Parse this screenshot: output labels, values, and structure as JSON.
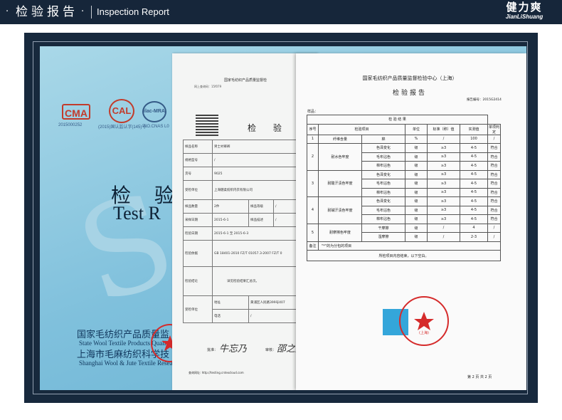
{
  "header": {
    "dot": "·",
    "title_cn": "检验报告",
    "title_en": "Inspection Report",
    "brand_cn": "健力爽",
    "brand_en": "JianLiShuang"
  },
  "cover": {
    "logo_ma": "CMA",
    "logo_cal": "CAL",
    "logo_ilac": "ilac-MRA",
    "code_ma": "2015000252",
    "code_cal": "(2015)国认监认字(145)号",
    "code_ilac": "NO.CNAS L0",
    "title_cn": "检 验",
    "title_en": "Test R",
    "inst_cn": "国家毛纺织产品质量监",
    "inst_en": "State Wool Textile Products Quali",
    "inst2_cn": "上海市毛麻纺织科学技",
    "inst2_en": "Shanghai Wool & Jute Textile Resea"
  },
  "sheet1": {
    "org": "国家毛纺织产品质量监督检",
    "report_no_label": "网上查询码：",
    "report_no": "15f079",
    "title": "检 验 报",
    "rows": {
      "sample_name": {
        "label": "样品名称",
        "value": "男士衬裤裤"
      },
      "spec": {
        "label": "规格型号",
        "value": "/"
      },
      "item_no": {
        "label": "货号",
        "value": "9025"
      },
      "client": {
        "label": "受检单位",
        "value": "上海健柔纺织内衣有限公司"
      },
      "qty": {
        "label": "样品数量",
        "value": "2件",
        "label2": "样品等级",
        "value2": "/"
      },
      "sample_date": {
        "label": "采样日期",
        "value": "2015-6-1",
        "label2": "样品描述",
        "value2": "/"
      },
      "test_date": {
        "label": "检验日期",
        "value": "2015-6-1 至 2015-6-3"
      },
      "basis": {
        "label": "检验依据",
        "value": "GB 18401-2010 FZ/T 01057.3-2007 FZ/T 0"
      },
      "conclusion": {
        "label": "检验结论",
        "value": "详见检验结果汇总页。"
      },
      "client_addr": {
        "label": "受检单位",
        "value_label": "地址",
        "value": "黄浦区人民路399号407",
        "tel_label": "电话",
        "tel": "/"
      }
    },
    "sign1": "批准：",
    "sign2": "审核：",
    "url": "查询网址: http://testing.cntexcloud.com"
  },
  "sheet2": {
    "org": "国家毛纺织产品质量监督检验中心（上海）",
    "title": "检验报告",
    "report_no": "报告编号：2015G2414",
    "sample_label": "样品：",
    "results_header": "检 验 结 果",
    "col_headers": [
      "序号",
      "检验项目",
      "单位",
      "标准（称）值",
      "实测值",
      "单项判定"
    ],
    "rows": [
      {
        "no": "1",
        "item": "纤维含量",
        "sub": "棉",
        "unit": "%",
        "std": "/",
        "measured": "100",
        "verdict": "/"
      },
      {
        "no": "2",
        "item": "耐水色牢度",
        "sub": "色泽变化",
        "unit": "级",
        "std": "≥3",
        "measured": "4-5",
        "verdict": "符合"
      },
      {
        "no": "",
        "item": "",
        "sub": "毛布沾色",
        "unit": "级",
        "std": "≥3",
        "measured": "4-5",
        "verdict": "符合"
      },
      {
        "no": "",
        "item": "",
        "sub": "棉布沾色",
        "unit": "级",
        "std": "≥3",
        "measured": "4-5",
        "verdict": "符合"
      },
      {
        "no": "3",
        "item": "耐酸汗渍色牢度",
        "sub": "色泽变化",
        "unit": "级",
        "std": "≥3",
        "measured": "4-5",
        "verdict": "符合"
      },
      {
        "no": "",
        "item": "",
        "sub": "毛布沾色",
        "unit": "级",
        "std": "≥3",
        "measured": "4-5",
        "verdict": "符合"
      },
      {
        "no": "",
        "item": "",
        "sub": "棉布沾色",
        "unit": "级",
        "std": "≥3",
        "measured": "4-5",
        "verdict": "符合"
      },
      {
        "no": "4",
        "item": "耐碱汗渍色牢度",
        "sub": "色泽变化",
        "unit": "级",
        "std": "≥3",
        "measured": "4-5",
        "verdict": "符合"
      },
      {
        "no": "",
        "item": "",
        "sub": "毛布沾色",
        "unit": "级",
        "std": "≥3",
        "measured": "4-5",
        "verdict": "符合"
      },
      {
        "no": "",
        "item": "",
        "sub": "棉布沾色",
        "unit": "级",
        "std": "≥3",
        "measured": "4-5",
        "verdict": "符合"
      },
      {
        "no": "5",
        "item": "耐摩擦色牢度",
        "sub": "干摩擦",
        "unit": "级",
        "std": "/",
        "measured": "4",
        "verdict": "/"
      },
      {
        "no": "",
        "item": "",
        "sub": "湿摩擦",
        "unit": "级",
        "std": "/",
        "measured": "2-3",
        "verdict": "/"
      }
    ],
    "remark_label": "备注",
    "remark": "\"*\"的为分包的项目",
    "end_text": "所检项目内容结束，以下空白。",
    "stamp_text": "(上海)",
    "page": "第 2 页 共 2 页"
  },
  "colors": {
    "header_bg": "#16263a",
    "frame_bg": "#17293d",
    "cover_blue": "#7fc0dc",
    "stamp_red": "#d52b2b",
    "blue_stamp": "#34a6da"
  }
}
